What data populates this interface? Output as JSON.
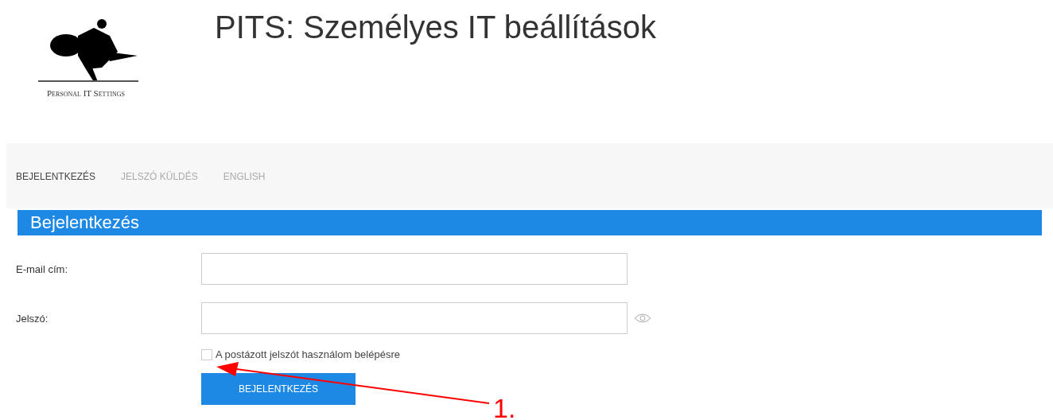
{
  "header": {
    "logo_caption": "Personal IT Settings",
    "title": "PITS: Személyes IT beállítások"
  },
  "nav": [
    {
      "label": "BEJELENTKEZÉS",
      "selected": true
    },
    {
      "label": "JELSZÓ KÜLDÉS",
      "selected": false
    },
    {
      "label": "ENGLISH",
      "selected": false
    }
  ],
  "panel": {
    "heading": "Bejelentkezés"
  },
  "form": {
    "fields": [
      {
        "label": "E-mail cím:",
        "kind": "text"
      },
      {
        "label": "Jelszó:",
        "kind": "password"
      }
    ],
    "checkbox": {
      "label": "A postázott jelszót használom belépésre",
      "checked": false
    },
    "submit": "BEJELENTKEZÉS"
  },
  "annotation": {
    "label": "1."
  }
}
